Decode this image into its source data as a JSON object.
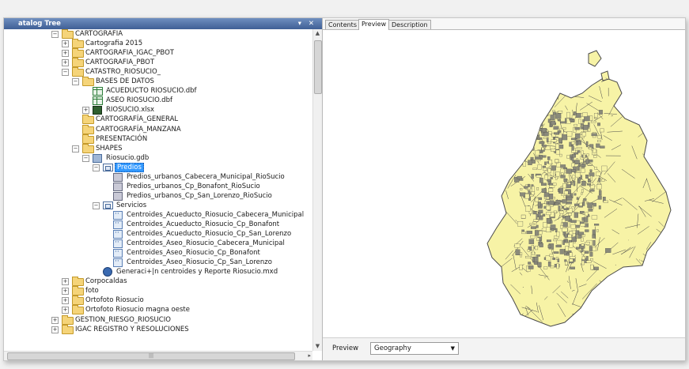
{
  "catalog": {
    "title": "atalog Tree",
    "pin_glyph": "▾",
    "close_glyph": "✕",
    "nodes": [
      {
        "label": "CARTOGRAFIA",
        "icon": "folder",
        "expander": "−"
      },
      {
        "label": "Cartografia 2015",
        "icon": "folder",
        "expander": "+"
      },
      {
        "label": "CARTOGRAFIA_IGAC_PBOT",
        "icon": "folder",
        "expander": "+"
      },
      {
        "label": "CARTOGRAFIA_PBOT",
        "icon": "folder",
        "expander": "+"
      },
      {
        "label": "CATASTRO_RIOSUCIO_",
        "icon": "folder",
        "expander": "−"
      },
      {
        "label": "BASES DE DATOS",
        "icon": "folder",
        "expander": "−"
      },
      {
        "label": "ACUEDUCTO RIOSUCIO.dbf",
        "icon": "table"
      },
      {
        "label": "ASEO RIOSUCIO.dbf",
        "icon": "table"
      },
      {
        "label": "RIOSUCIO.xlsx",
        "icon": "xls",
        "expander": "+"
      },
      {
        "label": "CARTOGRAFÍA_GENERAL",
        "icon": "folder"
      },
      {
        "label": "CARTOGRAFÍA_MANZANA",
        "icon": "folder"
      },
      {
        "label": "PRESENTACIÓN",
        "icon": "folder"
      },
      {
        "label": "SHAPES",
        "icon": "folder",
        "expander": "−"
      },
      {
        "label": "Riosucio.gdb",
        "icon": "gdb",
        "expander": "−"
      },
      {
        "label": "Predios",
        "icon": "feature-dataset",
        "expander": "−",
        "selected": true
      },
      {
        "label": "Predios_urbanos_Cabecera_Municipal_RioSucio",
        "icon": "polygon"
      },
      {
        "label": "Predios_urbanos_Cp_Bonafont_RioSucio",
        "icon": "polygon"
      },
      {
        "label": "Predios_urbanos_Cp_San_Lorenzo_RioSucio",
        "icon": "polygon"
      },
      {
        "label": "Servicios",
        "icon": "feature-dataset",
        "expander": "−"
      },
      {
        "label": "Centroides_Acueducto_Riosucio_Cabecera_Municipal",
        "icon": "point"
      },
      {
        "label": "Centroides_Acueducto_Riosucio_Cp_Bonafont",
        "icon": "point"
      },
      {
        "label": "Centroides_Acueducto_Riosucio_Cp_San_Lorenzo",
        "icon": "point"
      },
      {
        "label": "Centroides_Aseo_Riosucio_Cabecera_Municipal",
        "icon": "point"
      },
      {
        "label": "Centroides_Aseo_Riosucio_Cp_Bonafont",
        "icon": "point"
      },
      {
        "label": "Centroides_Aseo_Riosucio_Cp_San_Lorenzo",
        "icon": "point"
      },
      {
        "label": "Generaci+|n centroides y Reporte Riosucio.mxd",
        "icon": "map-document"
      },
      {
        "label": "Corpocaldas",
        "icon": "folder",
        "expander": "+"
      },
      {
        "label": "foto",
        "icon": "folder",
        "expander": "+"
      },
      {
        "label": "Ortofoto Riosucio",
        "icon": "folder",
        "expander": "+"
      },
      {
        "label": "Ortofoto Riosucio magna oeste",
        "icon": "folder",
        "expander": "+"
      },
      {
        "label": "GESTION_RIESGO_RIOSUCIO",
        "icon": "folder",
        "expander": "+"
      },
      {
        "label": "IGAC REGISTRO Y RESOLUCIONES",
        "icon": "folder",
        "expander": "+"
      }
    ]
  },
  "tabs": [
    {
      "label": "Contents",
      "active": false
    },
    {
      "label": "Preview",
      "active": true
    },
    {
      "label": "Description",
      "active": false
    }
  ],
  "preview": {
    "label": "Preview",
    "mode_value": "Geography",
    "dropdown_arrow": "▼",
    "map_fill_color": "#f7f3a6",
    "map_line_color": "#4a4a4a"
  },
  "scroll": {
    "up": "▲",
    "down": "▼",
    "right": "▸",
    "grip": "|||"
  }
}
